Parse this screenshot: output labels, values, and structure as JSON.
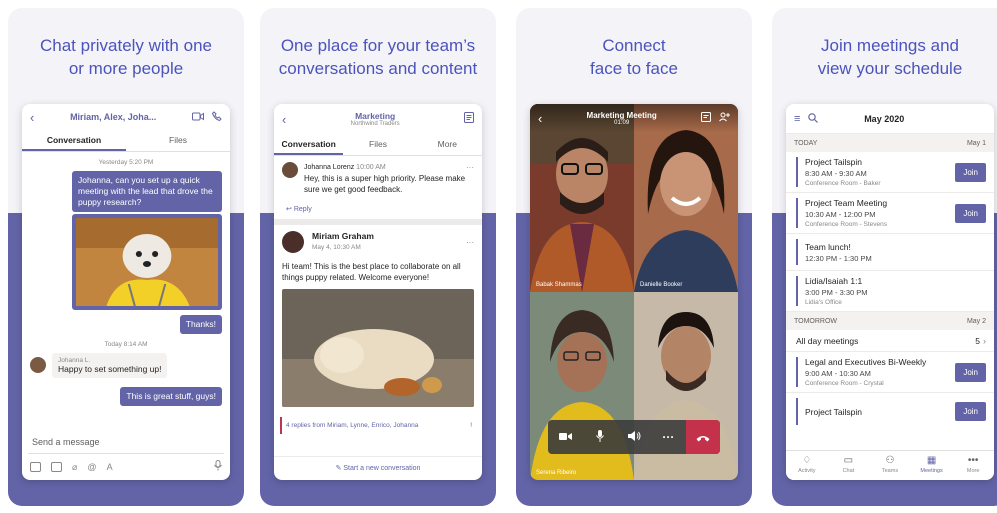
{
  "cards": [
    {
      "headline_l1": "Chat privately with one",
      "headline_l2": "or more people"
    },
    {
      "headline_l1": "One place for your team’s",
      "headline_l2": "conversations and content"
    },
    {
      "headline_l1": "Connect",
      "headline_l2": "face to face"
    },
    {
      "headline_l1": "Join meetings and",
      "headline_l2": "view your schedule"
    }
  ],
  "colors": {
    "brand": "#6264a7",
    "headline": "#4b53bc",
    "hangup": "#c4314b"
  },
  "chat": {
    "title": "Miriam, Alex, Joha...",
    "tab_conversation": "Conversation",
    "tab_files": "Files",
    "stamp_yesterday": "Yesterday 5:20 PM",
    "msg1": "Johanna, can you set up a quick meeting with the lead that drove the puppy research?",
    "msg_thanks": "Thanks!",
    "stamp_today": "Today 8:14 AM",
    "reply_sender": "Johanna L.",
    "reply_text": "Happy to set something up!",
    "msg_great": "This is great stuff, guys!",
    "compose_placeholder": "Send a message"
  },
  "channel": {
    "title": "Marketing",
    "subtitle": "Northwind Traders",
    "tab_conversations": "Conversation",
    "tab_files": "Files",
    "tab_more": "More",
    "post1_author": "Johanna Lorenz",
    "post1_time": "10:00 AM",
    "post1_text": "Hey, this is a super high priority. Please make sure we get good feedback.",
    "reply_label": "Reply",
    "post2_author": "Miriam Graham",
    "post2_time": "May 4, 10:30 AM",
    "post2_text": "Hi team! This is the best place to collaborate on all things puppy related. Welcome everyone!",
    "replies_summary": "4 replies from Miriam, Lynne, Enrico, Johanna",
    "new_conversation": "Start a new conversation"
  },
  "call": {
    "title": "Marketing Meeting",
    "duration": "01:09",
    "name1": "Babak Shammas",
    "name2": "Danielle Booker",
    "name3": "Serena Ribeiro"
  },
  "calendar": {
    "month": "May 2020",
    "today_label": "TODAY",
    "today_date": "May 1",
    "tomorrow_label": "TOMORROW",
    "tomorrow_date": "May 2",
    "join_label": "Join",
    "meetings_today": [
      {
        "name": "Project Tailspin",
        "time": "8:30 AM - 9:30 AM",
        "room": "Conference Room - Baker"
      },
      {
        "name": "Project Team Meeting",
        "time": "10:30 AM - 12:00 PM",
        "room": "Conference Room - Stevens"
      },
      {
        "name": "Team lunch!",
        "time": "12:30 PM - 1:30 PM",
        "room": ""
      },
      {
        "name": "Lidia/Isaiah 1:1",
        "time": "3:00 PM - 3:30 PM",
        "room": "Lidia's Office"
      }
    ],
    "all_day_label": "All day meetings",
    "all_day_count": "5",
    "meetings_tomorrow": [
      {
        "name": "Legal and Executives Bi-Weekly",
        "time": "9:00 AM - 10:30 AM",
        "room": "Conference Room - Crystal"
      },
      {
        "name": "Project Tailspin",
        "time": "",
        "room": ""
      }
    ],
    "tabs": [
      "Activity",
      "Chat",
      "Teams",
      "Meetings",
      "More"
    ]
  }
}
